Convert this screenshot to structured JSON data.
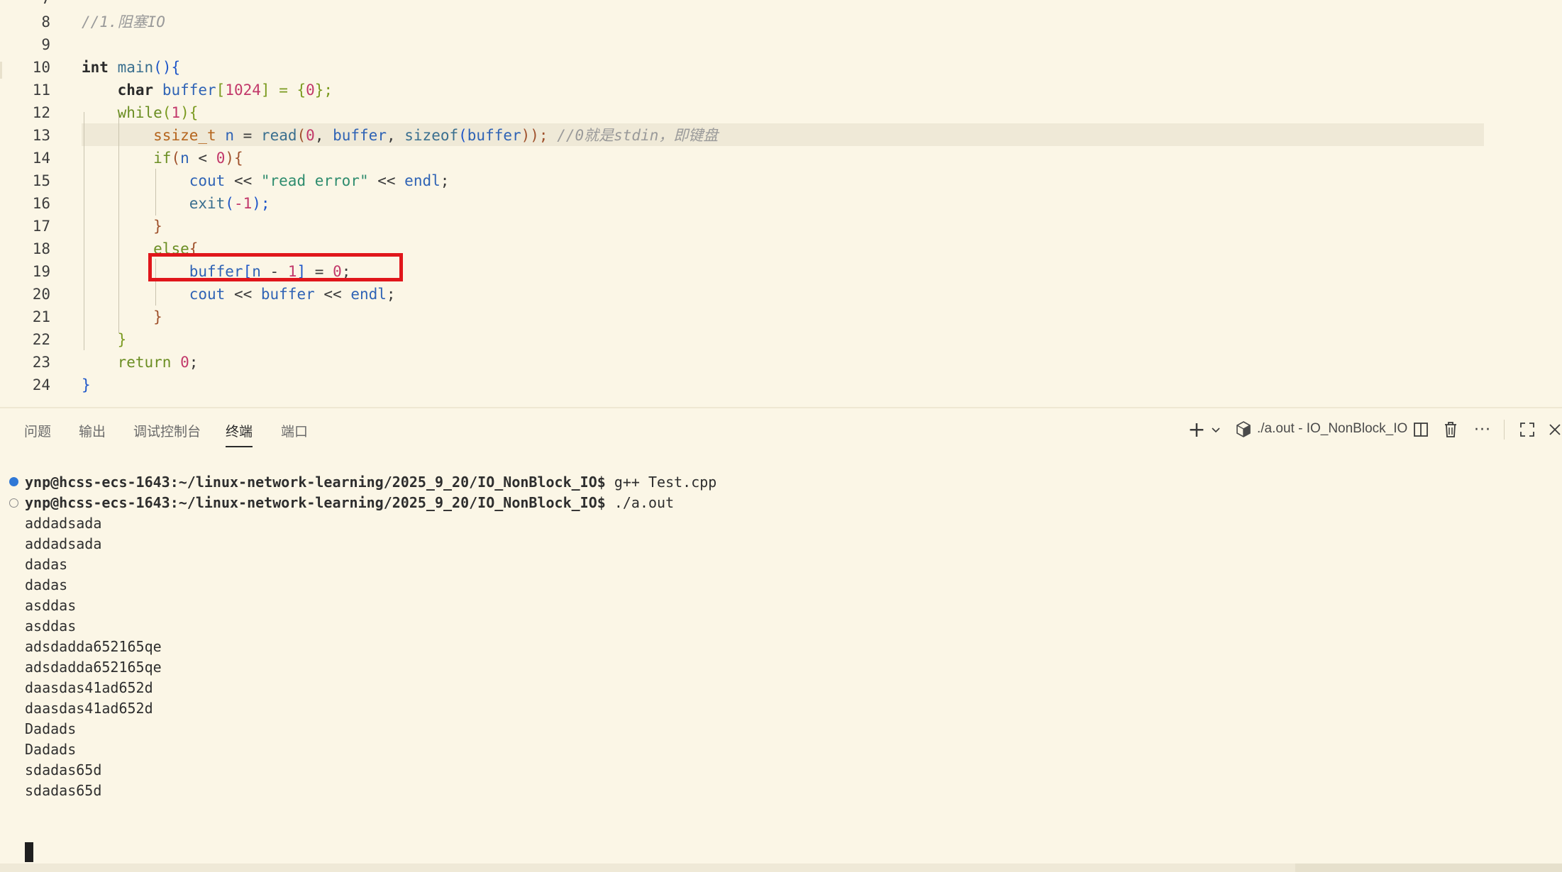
{
  "editor": {
    "top_partial_line_number": "7",
    "lines": [
      {
        "num": "8"
      },
      {
        "num": "9"
      },
      {
        "num": "10"
      },
      {
        "num": "11"
      },
      {
        "num": "12"
      },
      {
        "num": "13"
      },
      {
        "num": "14"
      },
      {
        "num": "15"
      },
      {
        "num": "16"
      },
      {
        "num": "17"
      },
      {
        "num": "18"
      },
      {
        "num": "19"
      },
      {
        "num": "20"
      },
      {
        "num": "21"
      },
      {
        "num": "22"
      },
      {
        "num": "23"
      },
      {
        "num": "24"
      }
    ],
    "tokens": {
      "l8_comment": "//1.阻塞IO",
      "l10_int": "int",
      "l10_main": "main",
      "l10_paren": "(){",
      "l11_char": "char",
      "l11_buffer": "buffer",
      "l11_lb": "[",
      "l11_1024": "1024",
      "l11_rest1": "] = {",
      "l11_0": "0",
      "l11_rest2": "};",
      "l12_while": "while",
      "l12_p1": "(",
      "l12_1": "1",
      "l12_p2": "){",
      "l13_ssize": "ssize_t",
      "l13_n": "n",
      "l13_eq": " = ",
      "l13_read": "read",
      "l13_p1": "(",
      "l13_0": "0",
      "l13_c1": ", ",
      "l13_buffer": "buffer",
      "l13_c2": ", ",
      "l13_sizeof": "sizeof",
      "l13_p2": "(",
      "l13_buffer2": "buffer",
      "l13_p3": "));",
      "l13_comment": " //0就是stdin，即键盘",
      "l14_if": "if",
      "l14_p1": "(",
      "l14_n": "n",
      "l14_lt": " < ",
      "l14_0": "0",
      "l14_p2": "){",
      "l15_cout": "cout",
      "l15_op1": " << ",
      "l15_str": "\"read error\"",
      "l15_op2": " << ",
      "l15_endl": "endl",
      "l15_semi": ";",
      "l16_exit": "exit",
      "l16_p1": "(",
      "l16_neg": "-1",
      "l16_p2": ");",
      "l17_brace": "}",
      "l18_else": "else",
      "l18_brace": "{",
      "l19_buffer": "buffer",
      "l19_lb": "[",
      "l19_n": "n",
      "l19_minus": " - ",
      "l19_1": "1",
      "l19_rb": "]",
      "l19_eq": " = ",
      "l19_0": "0",
      "l19_semi": ";",
      "l20_cout": "cout",
      "l20_op1": " << ",
      "l20_buffer": "buffer",
      "l20_op2": " << ",
      "l20_endl": "endl",
      "l20_semi": ";",
      "l21_brace": "}",
      "l22_brace": "}",
      "l23_return": "return",
      "l23_0": "0",
      "l23_semi": ";",
      "l24_brace": "}"
    }
  },
  "panel": {
    "tabs": [
      {
        "label": "问题"
      },
      {
        "label": "输出"
      },
      {
        "label": "调试控制台"
      },
      {
        "label": "终端"
      },
      {
        "label": "端口"
      }
    ],
    "active_tab": "终端",
    "terminal_name": "./a.out - IO_NonBlock_IO",
    "icons": [
      "plus-icon",
      "chevron-down-icon",
      "terminal-shell-icon",
      "split-icon",
      "trash-icon",
      "more-icon",
      "maximize-icon",
      "close-icon"
    ]
  },
  "terminal": {
    "prompt": "ynp@hcss-ecs-1643:~/linux-network-learning/2025_9_20/IO_NonBlock_IO$",
    "commands": [
      " g++ Test.cpp",
      " ./a.out"
    ],
    "output": [
      "addadsada",
      "addadsada",
      "dadas",
      "dadas",
      "asddas",
      "asddas",
      "adsdadda652165qe",
      "adsdadda652165qe",
      "daasdas41ad652d",
      "daasdas41ad652d",
      "Dadads",
      "Dadads",
      "sdadas65d",
      "sdadas65d"
    ]
  },
  "colors": {
    "background": "#FBF6E6",
    "highlight_box": "#E0161B",
    "keyword_type": "#2B2B2B",
    "function": "#3A6F8F",
    "variable": "#2F63B5",
    "number": "#C2386A",
    "string": "#2E8C6E",
    "control": "#6B8E23",
    "comment": "#9A9A9A",
    "terminal_dot": "#2F78D6"
  }
}
